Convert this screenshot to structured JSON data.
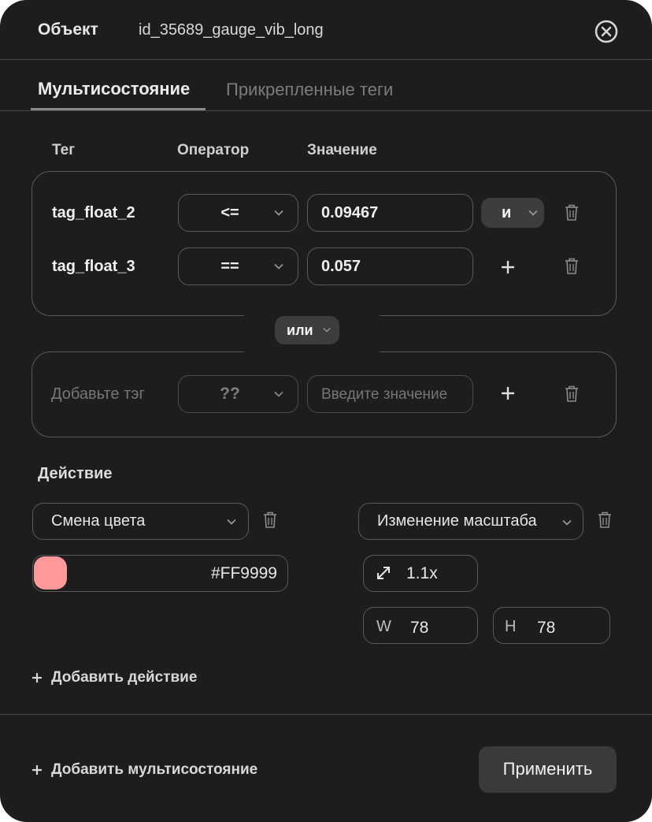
{
  "header": {
    "label": "Объект",
    "object_id": "id_35689_gauge_vib_long"
  },
  "tabs": [
    {
      "label": "Мультисостояние",
      "active": true
    },
    {
      "label": "Прикрепленные теги",
      "active": false
    }
  ],
  "columns": {
    "tag": "Тег",
    "operator": "Оператор",
    "value": "Значение"
  },
  "group1": {
    "rows": [
      {
        "tag": "tag_float_2",
        "operator": "<=",
        "value": "0.09467",
        "connector": "и"
      },
      {
        "tag": "tag_float_3",
        "operator": "==",
        "value": "0.057"
      }
    ]
  },
  "group_connector": "или",
  "group2": {
    "tag_placeholder": "Добавьте тэг",
    "operator": "??",
    "value_placeholder": "Введите значение"
  },
  "actions": {
    "title": "Действие",
    "color_action": {
      "label": "Смена цвета",
      "color_hex": "#FF9999",
      "swatch_color": "#ff9999"
    },
    "scale_action": {
      "label": "Изменение масштаба",
      "scale": "1.1x",
      "w_label": "W",
      "w_value": "78",
      "h_label": "H",
      "h_value": "78"
    },
    "add_action": "Добавить действие"
  },
  "footer": {
    "add_multistate": "Добавить мультисостояние",
    "apply": "Применить"
  },
  "colors": {
    "panel_bg": "#1d1d1e",
    "border": "#5a5a5c",
    "muted_text": "#8e8e90",
    "button_bg": "#3a3a3c"
  }
}
